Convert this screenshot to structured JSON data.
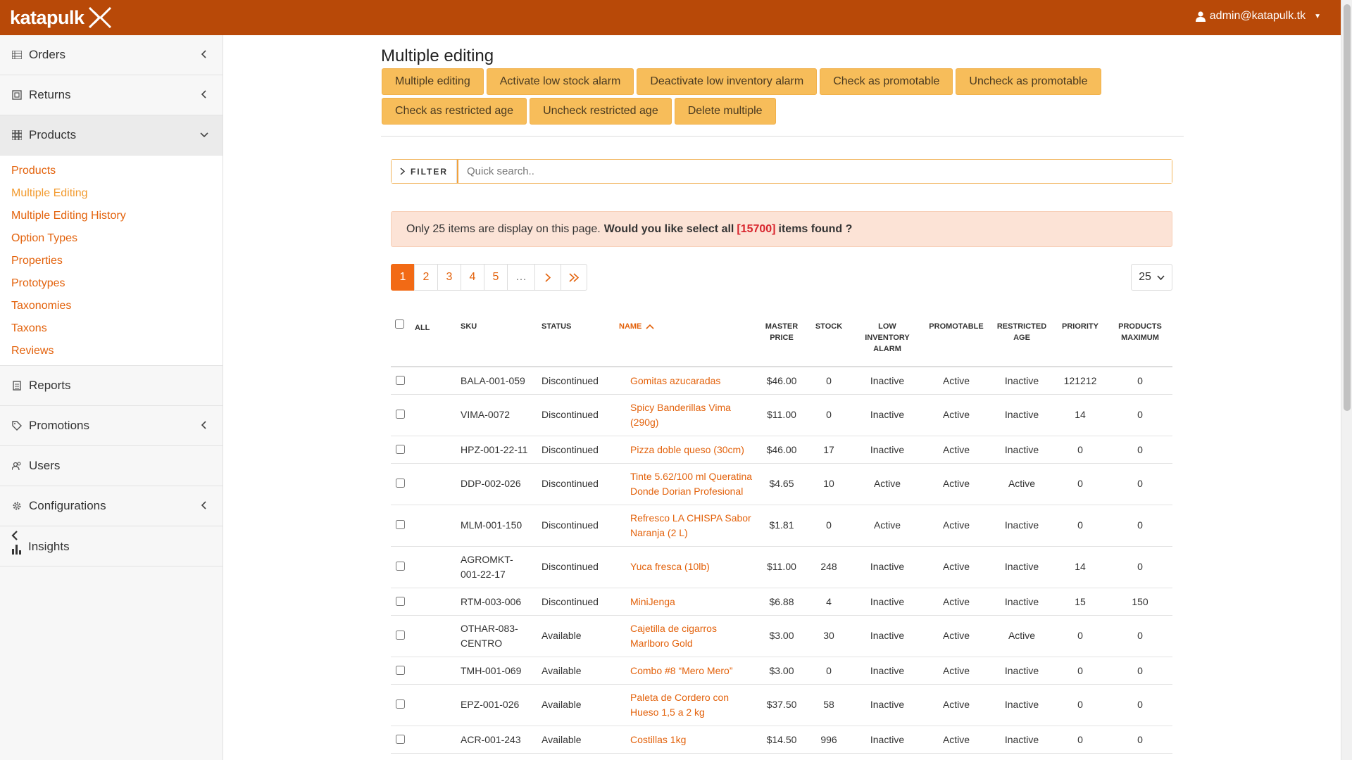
{
  "brand": {
    "name": "katapulk"
  },
  "user": {
    "email": "admin@katapulk.tk"
  },
  "sidebar": {
    "items": [
      {
        "label": "Orders"
      },
      {
        "label": "Returns"
      },
      {
        "label": "Products"
      },
      {
        "label": "Reports"
      },
      {
        "label": "Promotions"
      },
      {
        "label": "Users"
      },
      {
        "label": "Configurations"
      },
      {
        "label": "Insights"
      }
    ],
    "products_submenu": [
      "Products",
      "Multiple Editing",
      "Multiple Editing History",
      "Option Types",
      "Properties",
      "Prototypes",
      "Taxonomies",
      "Taxons",
      "Reviews"
    ]
  },
  "main": {
    "title": "Multiple editing",
    "actions_row1": [
      "Multiple editing",
      "Activate low stock alarm",
      "Deactivate low inventory alarm",
      "Check as promotable",
      "Uncheck as promotable"
    ],
    "actions_row2": [
      "Check as restricted age",
      "Uncheck restricted age",
      "Delete multiple"
    ],
    "filter": {
      "label": "FILTER",
      "placeholder": "Quick search.."
    },
    "alert": {
      "text1": "Only 25 items are display on this page.",
      "text2": "Would you like select all",
      "count": "[15700]",
      "text3": "items found ?"
    },
    "pagination": {
      "pages": [
        "1",
        "2",
        "3",
        "4",
        "5",
        "…"
      ],
      "per_page": "25"
    },
    "table": {
      "headers": {
        "all": "ALL",
        "sku": "SKU",
        "status": "STATUS",
        "name": "NAME",
        "master_price_1": "MASTER",
        "master_price_2": "PRICE",
        "stock": "STOCK",
        "low_1": "LOW",
        "low_2": "INVENTORY",
        "low_3": "ALARM",
        "promotable": "PROMOTABLE",
        "restricted_1": "RESTRICTED",
        "restricted_2": "AGE",
        "priority": "PRIORITY",
        "max_1": "PRODUCTS",
        "max_2": "MAXIMUM"
      },
      "rows": [
        {
          "sku1": "BALA-001-059",
          "sku2": "",
          "status": "Discontinued",
          "name1": "Gomitas azucaradas",
          "name2": "",
          "price": "$46.00",
          "stock": "0",
          "low": "Inactive",
          "promo": "Active",
          "restricted": "Inactive",
          "priority": "121212",
          "max": "0"
        },
        {
          "sku1": "VIMA-0072",
          "sku2": "",
          "status": "Discontinued",
          "name1": "Spicy Banderillas Vima",
          "name2": "(290g)",
          "price": "$11.00",
          "stock": "0",
          "low": "Inactive",
          "promo": "Active",
          "restricted": "Inactive",
          "priority": "14",
          "max": "0"
        },
        {
          "sku1": "HPZ-001-22-11",
          "sku2": "",
          "status": "Discontinued",
          "name1": "Pizza doble queso (30cm)",
          "name2": "",
          "price": "$46.00",
          "stock": "17",
          "low": "Inactive",
          "promo": "Active",
          "restricted": "Inactive",
          "priority": "0",
          "max": "0"
        },
        {
          "sku1": "DDP-002-026",
          "sku2": "",
          "status": "Discontinued",
          "name1": "Tinte 5.62/100 ml Queratina",
          "name2": "Donde Dorian Profesional",
          "price": "$4.65",
          "stock": "10",
          "low": "Active",
          "promo": "Active",
          "restricted": "Active",
          "priority": "0",
          "max": "0"
        },
        {
          "sku1": "MLM-001-150",
          "sku2": "",
          "status": "Discontinued",
          "name1": "Refresco LA CHISPA Sabor",
          "name2": "Naranja (2 L)",
          "price": "$1.81",
          "stock": "0",
          "low": "Active",
          "promo": "Active",
          "restricted": "Inactive",
          "priority": "0",
          "max": "0"
        },
        {
          "sku1": "AGROMKT-",
          "sku2": "001-22-17",
          "status": "Discontinued",
          "name1": "Yuca fresca (10lb)",
          "name2": "",
          "price": "$11.00",
          "stock": "248",
          "low": "Inactive",
          "promo": "Active",
          "restricted": "Inactive",
          "priority": "14",
          "max": "0"
        },
        {
          "sku1": "RTM-003-006",
          "sku2": "",
          "status": "Discontinued",
          "name1": "MiniJenga",
          "name2": "",
          "price": "$6.88",
          "stock": "4",
          "low": "Inactive",
          "promo": "Active",
          "restricted": "Inactive",
          "priority": "15",
          "max": "150"
        },
        {
          "sku1": "OTHAR-083-",
          "sku2": "CENTRO",
          "status": "Available",
          "name1": "Cajetilla de cigarros",
          "name2": "Marlboro Gold",
          "price": "$3.00",
          "stock": "30",
          "low": "Inactive",
          "promo": "Active",
          "restricted": "Active",
          "priority": "0",
          "max": "0"
        },
        {
          "sku1": "TMH-001-069",
          "sku2": "",
          "status": "Available",
          "name1": "Combo #8 “Mero Mero”",
          "name2": "",
          "price": "$3.00",
          "stock": "0",
          "low": "Inactive",
          "promo": "Active",
          "restricted": "Inactive",
          "priority": "0",
          "max": "0"
        },
        {
          "sku1": "EPZ-001-026",
          "sku2": "",
          "status": "Available",
          "name1": "Paleta de Cordero con",
          "name2": "Hueso 1,5 a 2 kg",
          "price": "$37.50",
          "stock": "58",
          "low": "Inactive",
          "promo": "Active",
          "restricted": "Inactive",
          "priority": "0",
          "max": "0"
        },
        {
          "sku1": "ACR-001-243",
          "sku2": "",
          "status": "Available",
          "name1": "Costillas 1kg",
          "name2": "",
          "price": "$14.50",
          "stock": "996",
          "low": "Inactive",
          "promo": "Active",
          "restricted": "Inactive",
          "priority": "0",
          "max": "0"
        }
      ]
    }
  },
  "colors": {
    "topbar": "#b84908",
    "accent": "#e3620c",
    "button": "#f7bd5a",
    "alert_bg": "#fce3d6"
  }
}
